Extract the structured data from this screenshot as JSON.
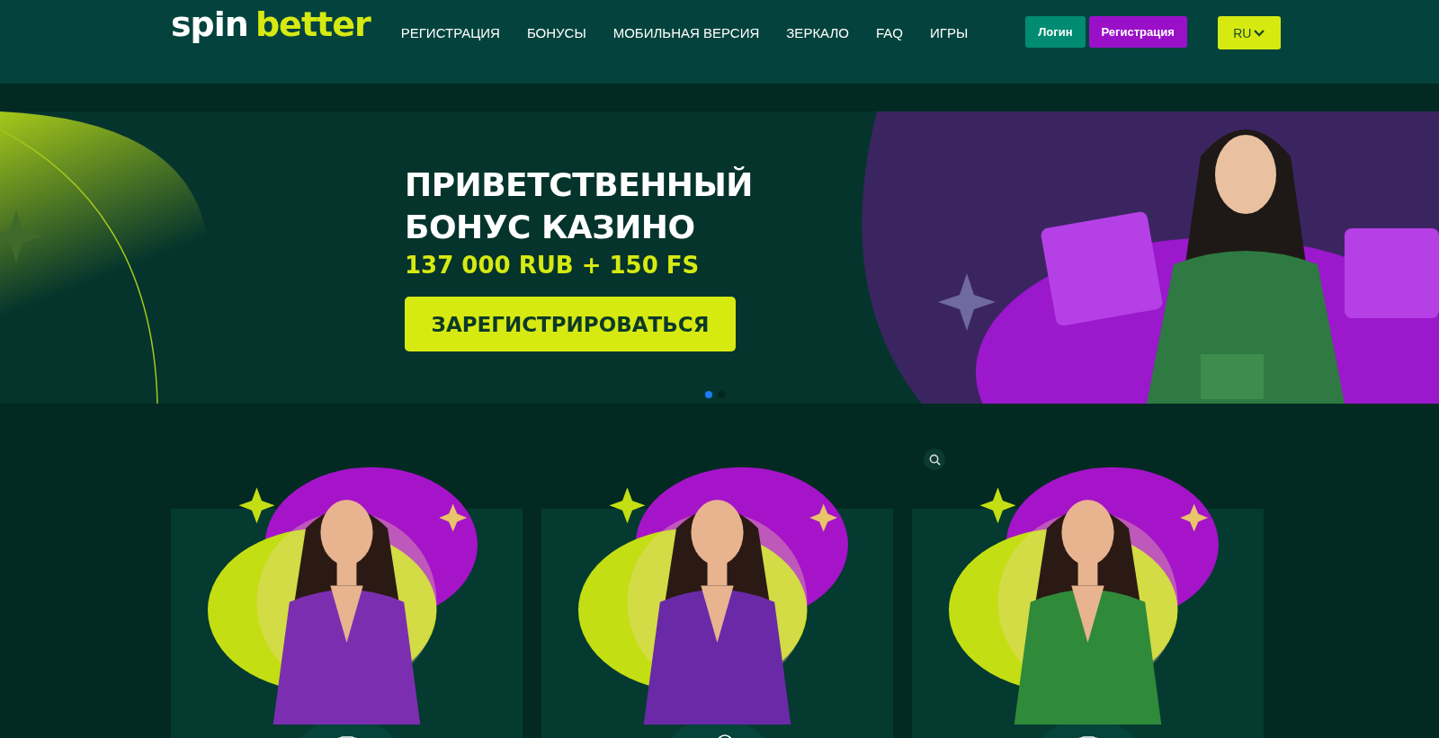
{
  "header": {
    "logo": {
      "part_1": "spin",
      "part_2": "better"
    },
    "nav": [
      "РЕГИСТРАЦИЯ",
      "БОНУСЫ",
      "МОБИЛЬНАЯ ВЕРСИЯ",
      "ЗЕРКАЛО",
      "FAQ",
      "ИГРЫ"
    ],
    "login_button": "Логин",
    "register_button": "Регистрация",
    "language": "RU"
  },
  "banner": {
    "title_line_1": "ПРИВЕТСТВЕННЫЙ",
    "title_line_2": "БОНУС КАЗИНО",
    "amount": "137 000 RUB + 150 FS",
    "cta": "ЗАРЕГИСТРИРОВАТЬСЯ",
    "dots": [
      {
        "selected": true
      },
      {
        "selected": false
      }
    ]
  },
  "cards": [
    {
      "kind": "cards"
    },
    {
      "kind": "chip"
    },
    {
      "kind": "cards"
    }
  ]
}
